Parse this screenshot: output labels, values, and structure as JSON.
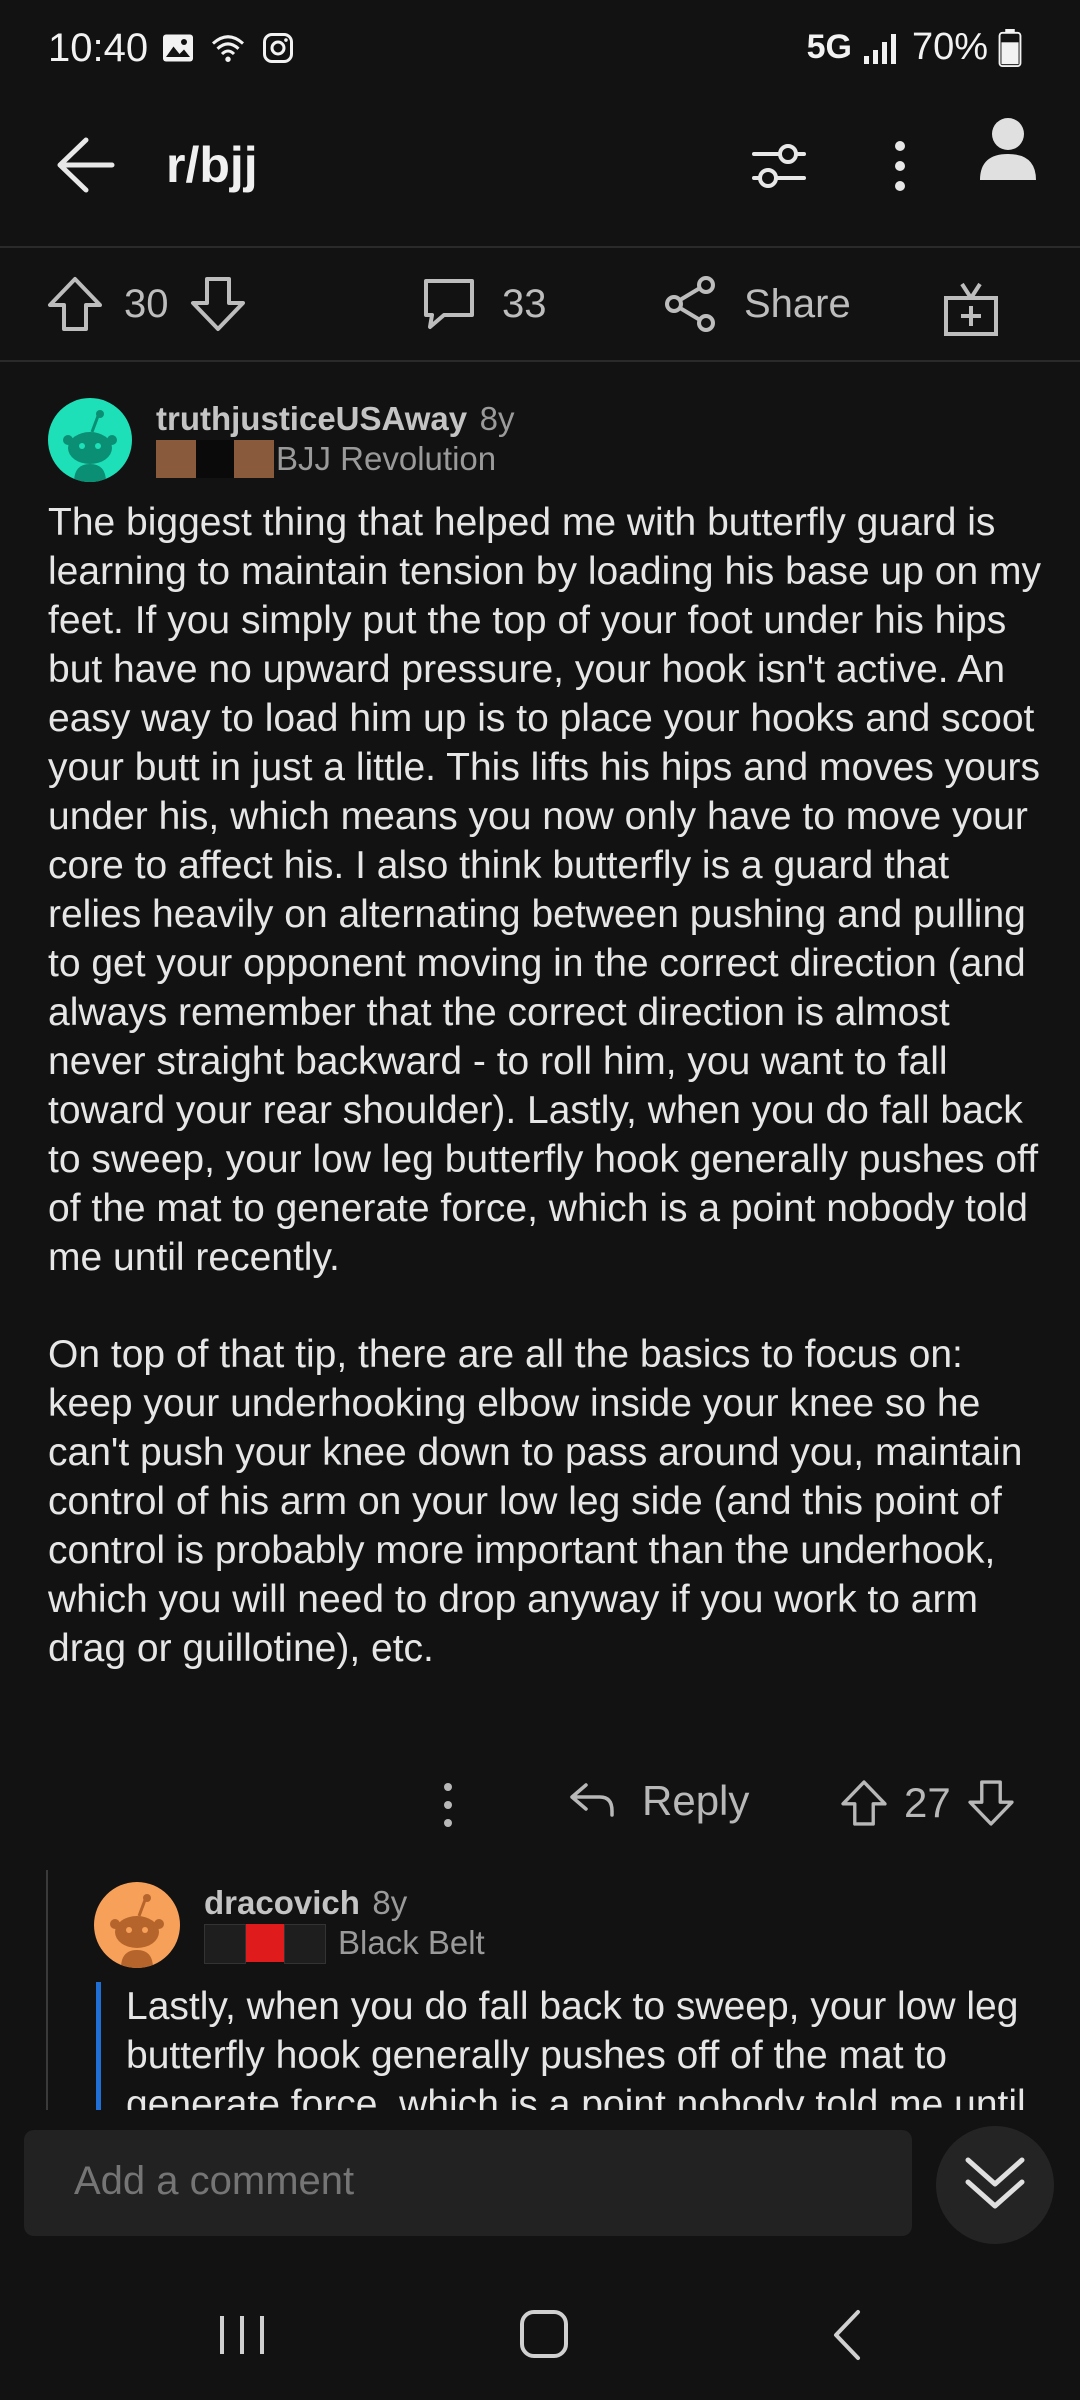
{
  "status": {
    "time": "10:40",
    "network": "5G",
    "battery": "70%",
    "icons_left": [
      "gallery-icon",
      "wifi-icon",
      "instagram-icon"
    ]
  },
  "appbar": {
    "subreddit": "r/bjj"
  },
  "actions": {
    "upvotes": "30",
    "comments": "33",
    "share_label": "Share"
  },
  "comment": {
    "author": "truthjusticeUSAway",
    "age": "8y",
    "flair": "BJJ Revolution",
    "paragraphs": [
      "The biggest thing that helped me with butterfly guard is learning to maintain tension by loading his base up on my feet. If you simply put the top of your foot under his hips but have no upward pressure, your hook isn't active. An easy way to load him up is to place your hooks and scoot your butt in just a little. This lifts his hips and moves yours under his, which means you now only have to move your core to affect his. I also think butterfly is a guard that relies heavily on alternating between pushing and pulling to get your opponent moving in the correct direction (and always remember that the correct direction is almost never straight backward - to roll him, you want to fall toward your rear shoulder). Lastly, when you do fall back to sweep, your low leg butterfly hook generally pushes off of the mat to generate force, which is a point nobody told me until recently.",
      "On top of that tip, there are all the basics to focus on: keep your underhooking elbow inside your knee so he can't push your knee down to pass around you, maintain control of his arm on your low leg side (and this point of control is probably more important than the underhook, which you will need to drop anyway if you work to arm drag or guillotine), etc."
    ],
    "reply_label": "Reply",
    "score": "27"
  },
  "reply": {
    "author": "dracovich",
    "age": "8y",
    "flair": "Black Belt",
    "quote": "Lastly, when you do fall back to sweep, your low leg butterfly hook generally pushes off of the mat to generate force, which is a point nobody told me until recently."
  },
  "composer": {
    "placeholder": "Add a comment"
  },
  "colors": {
    "background": "#121212",
    "avatar_teal": "#1ee0b8",
    "avatar_orange": "#f7a05a",
    "quote_bar": "#1f6fd6",
    "flair_red": "#e01b1b",
    "flair_brown": "#8a5a3c"
  }
}
